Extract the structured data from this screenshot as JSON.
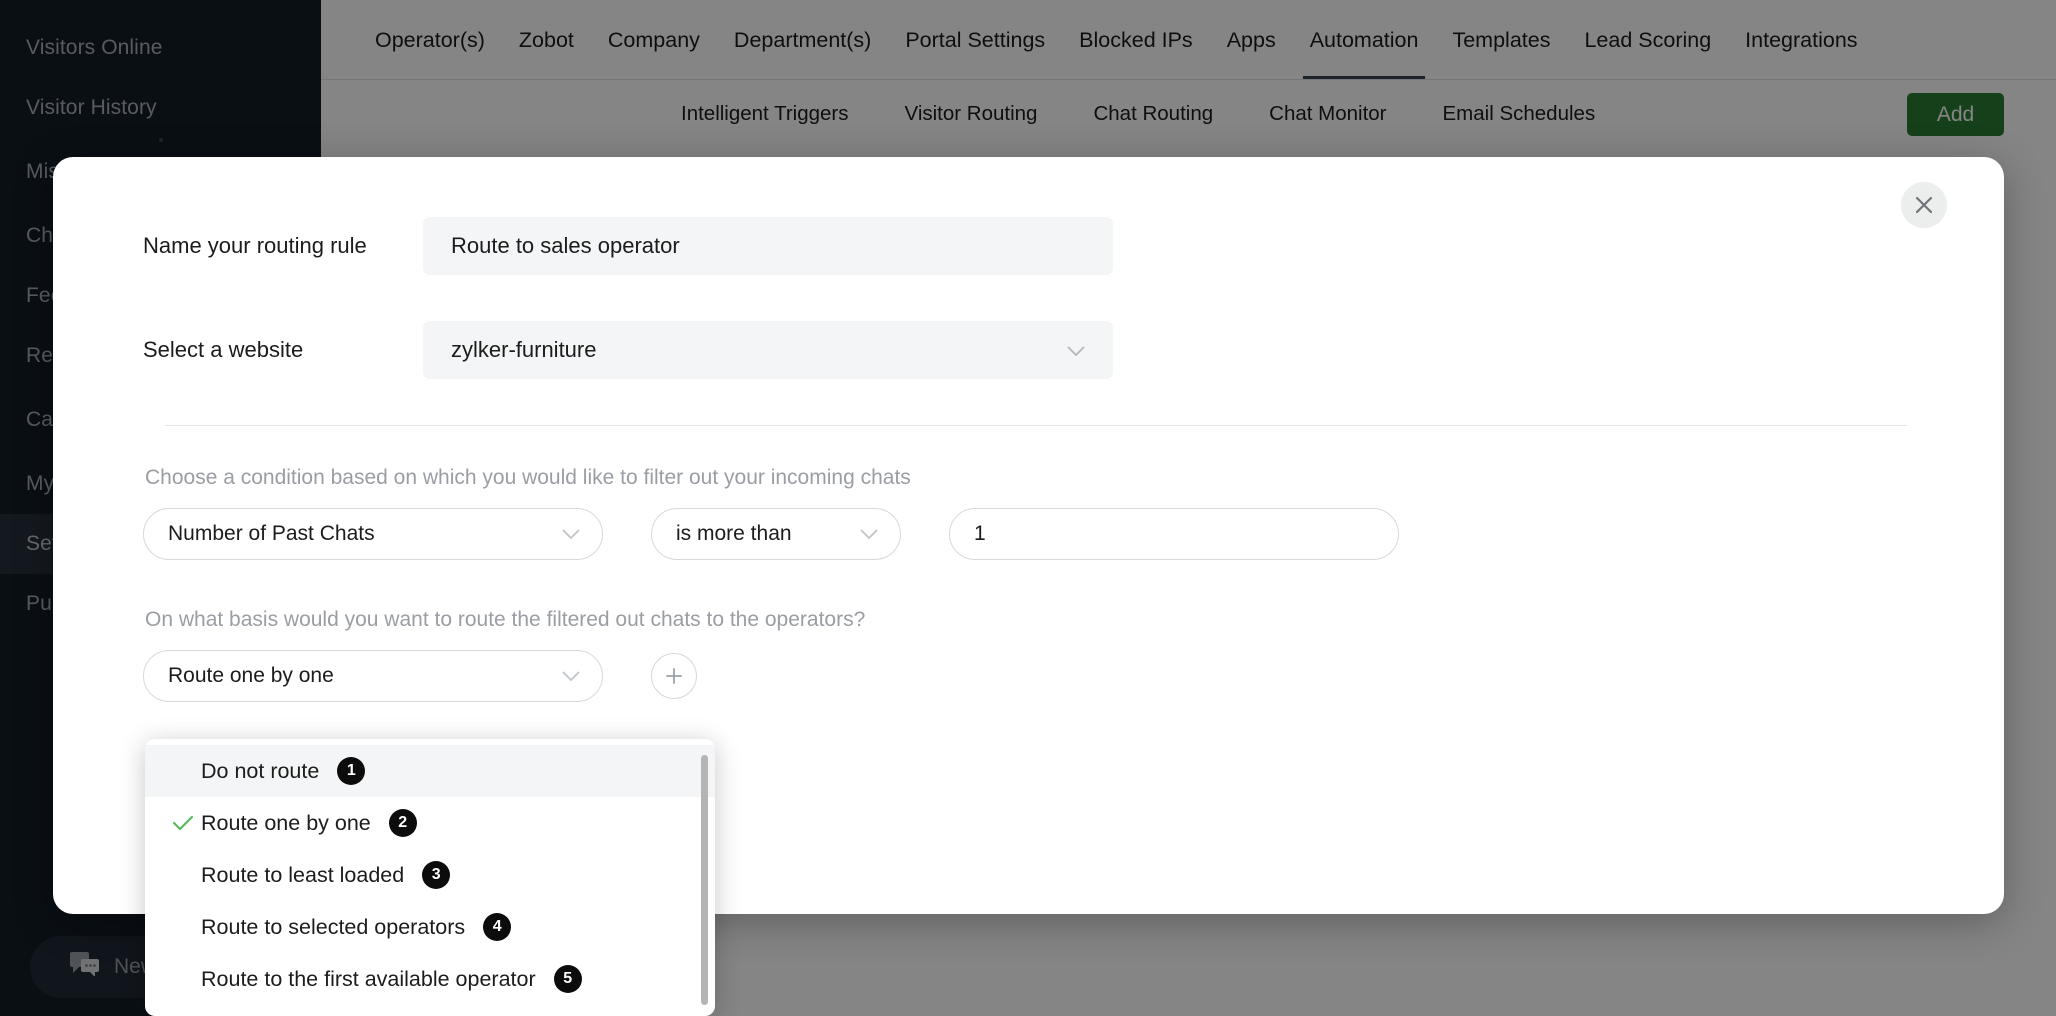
{
  "sidebar": {
    "items": [
      {
        "label": "Visitors Online",
        "active": false
      },
      {
        "label": "Visitor History",
        "active": false
      },
      {
        "label": "Missed Chats",
        "active": false
      },
      {
        "label": "Chats",
        "active": false
      },
      {
        "label": "Feedback",
        "active": false
      },
      {
        "label": "Reports",
        "active": false
      },
      {
        "label": "Canned Responses",
        "active": false
      },
      {
        "label": "My Profile",
        "active": false
      },
      {
        "label": "Settings",
        "active": true
      },
      {
        "label": "Purchase",
        "active": false
      }
    ],
    "chat_widget_label": "New Chat"
  },
  "topnav": {
    "items": [
      {
        "label": "Operator(s)",
        "active": false
      },
      {
        "label": "Zobot",
        "active": false
      },
      {
        "label": "Company",
        "active": false
      },
      {
        "label": "Department(s)",
        "active": false
      },
      {
        "label": "Portal Settings",
        "active": false
      },
      {
        "label": "Blocked IPs",
        "active": false
      },
      {
        "label": "Apps",
        "active": false
      },
      {
        "label": "Automation",
        "active": true
      },
      {
        "label": "Templates",
        "active": false
      },
      {
        "label": "Lead Scoring",
        "active": false
      },
      {
        "label": "Integrations",
        "active": false
      }
    ]
  },
  "subnav": {
    "items": [
      {
        "label": "Intelligent Triggers"
      },
      {
        "label": "Visitor Routing"
      },
      {
        "label": "Chat Routing"
      },
      {
        "label": "Chat Monitor"
      },
      {
        "label": "Email Schedules"
      }
    ],
    "add_label": "Add",
    "add_color": "#2a7b32"
  },
  "modal": {
    "close_icon": "close-icon",
    "name_label": "Name your routing rule",
    "name_value": "Route to sales operator",
    "name_placeholder": "Name your routing rule",
    "website_label": "Select a website",
    "website_value": "zylker-furniture",
    "condition_helper": "Choose a condition based on which you would like to filter out your incoming chats",
    "condition_field": "Number of Past Chats",
    "condition_operator": "is more than",
    "condition_value": "1",
    "condition_value_placeholder": "",
    "route_helper": "On what basis would you want to route the filtered out chats to the operators?",
    "route_value": "Route one by one",
    "add_condition_icon": "plus-icon"
  },
  "dropdown": {
    "checkmark_color": "#5cb85c",
    "items": [
      {
        "label": "Do not route",
        "badge": "1",
        "checked": false,
        "hover": true
      },
      {
        "label": "Route one by one",
        "badge": "2",
        "checked": true,
        "hover": false
      },
      {
        "label": "Route to least loaded",
        "badge": "3",
        "checked": false,
        "hover": false
      },
      {
        "label": "Route to selected operators",
        "badge": "4",
        "checked": false,
        "hover": false
      },
      {
        "label": "Route to the first available operator",
        "badge": "5",
        "checked": false,
        "hover": false
      }
    ]
  }
}
